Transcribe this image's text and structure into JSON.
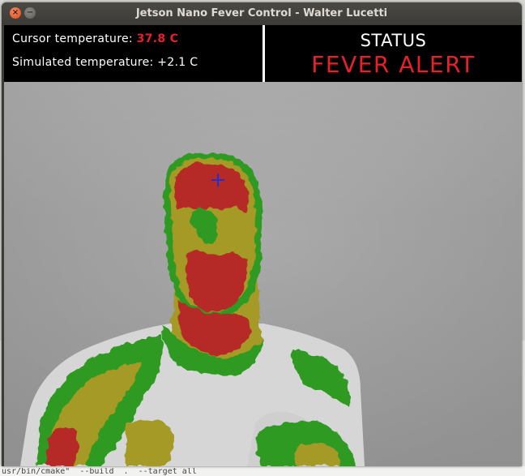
{
  "window": {
    "title": "Jetson Nano Fever Control - Walter Lucetti",
    "close_glyph": "×",
    "minimize_glyph": "−"
  },
  "info": {
    "cursor_label": "Cursor temperature:",
    "cursor_value": "37.8 C",
    "simulated_label": "Simulated temperature:",
    "simulated_value": "+2.1 C"
  },
  "status": {
    "label": "STATUS",
    "value": "FEVER ALERT"
  },
  "terminal": {
    "text": "usr/bin/cmake\"  --build  .  --target all"
  },
  "thermal": {
    "palette": [
      "gray",
      "green",
      "olive",
      "red"
    ]
  },
  "colors": {
    "alert_red": "#e8202a",
    "hot_red": "#b52a26",
    "warm_olive": "#a69a26",
    "mild_green": "#2f9a21",
    "crosshair_blue": "#1f2fd0"
  }
}
